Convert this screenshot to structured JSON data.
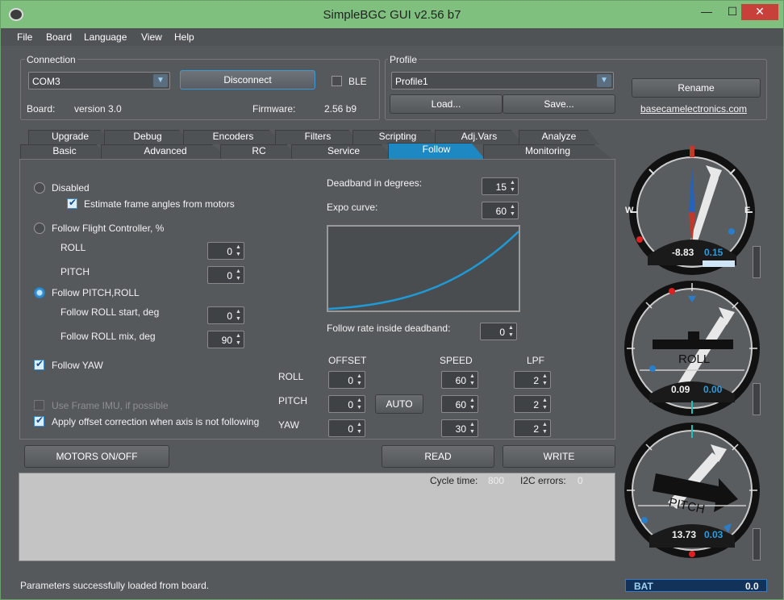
{
  "window": {
    "title": "SimpleBGC GUI v2.56 b7",
    "min": "—",
    "max": "☐",
    "close": "✕"
  },
  "menu": [
    "File",
    "Board",
    "Language",
    "View",
    "Help"
  ],
  "connection": {
    "group_label": "Connection",
    "port": "COM3",
    "disconnect_label": "Disconnect",
    "ble_label": "BLE",
    "board_label": "Board:",
    "board_value": "version 3.0",
    "firmware_label": "Firmware:",
    "firmware_value": "2.56 b9"
  },
  "profile": {
    "group_label": "Profile",
    "selected": "Profile1",
    "load_label": "Load...",
    "save_label": "Save...",
    "rename_label": "Rename",
    "link": "basecamelectronics.com"
  },
  "tabs_row1": [
    "Upgrade",
    "Debug",
    "Encoders",
    "Filters",
    "Scripting",
    "Adj.Vars",
    "Analyze"
  ],
  "tabs_row2": [
    "Basic",
    "Advanced",
    "RC",
    "Service",
    "Follow",
    "Monitoring"
  ],
  "active_tab": "Follow",
  "follow": {
    "disabled_label": "Disabled",
    "estimate_label": "Estimate frame angles from motors",
    "follow_fc_label": "Follow Flight Controller, %",
    "roll_label": "ROLL",
    "roll_value": "0",
    "pitch_label": "PITCH",
    "pitch_value": "0",
    "follow_pitch_roll_label": "Follow PITCH,ROLL",
    "roll_start_label": "Follow ROLL start, deg",
    "roll_start_value": "0",
    "roll_mix_label": "Follow ROLL mix, deg",
    "roll_mix_value": "90",
    "follow_yaw_label": "Follow YAW",
    "use_imu_label": "Use Frame IMU, if possible",
    "apply_offset_label": "Apply offset correction when axis is not following",
    "deadband_label": "Deadband in degrees:",
    "deadband_value": "15",
    "expo_label": "Expo curve:",
    "expo_value": "60",
    "rate_label": "Follow rate inside deadband:",
    "rate_value": "0",
    "col_offset": "OFFSET",
    "col_speed": "SPEED",
    "col_lpf": "LPF",
    "auto_label": "AUTO",
    "axes": [
      {
        "name": "ROLL",
        "offset": "0",
        "speed": "60",
        "lpf": "2"
      },
      {
        "name": "PITCH",
        "offset": "0",
        "speed": "60",
        "lpf": "2"
      },
      {
        "name": "YAW",
        "offset": "0",
        "speed": "30",
        "lpf": "2"
      }
    ]
  },
  "buttons": {
    "motors": "MOTORS ON/OFF",
    "read": "READ",
    "write": "WRITE"
  },
  "log": {
    "cycle_label": "Cycle time:",
    "cycle_value": "800",
    "i2c_label": "I2C errors:",
    "i2c_value": "0"
  },
  "status": {
    "message": "Parameters successfully loaded from board.",
    "bat_label": "BAT",
    "bat_value": "0.0"
  },
  "gauges": {
    "yaw": {
      "angle": "-8.83",
      "rate": "0.15",
      "west": "W",
      "east": "E"
    },
    "roll": {
      "label": "ROLL",
      "angle": "0.09",
      "rate": "0.00"
    },
    "pitch": {
      "label": "PITCH",
      "angle": "13.73",
      "rate": "0.03"
    }
  },
  "colors": {
    "accent": "#1d88c2",
    "titlebar": "#7fc07f",
    "rate_text": "#2a9de0"
  }
}
